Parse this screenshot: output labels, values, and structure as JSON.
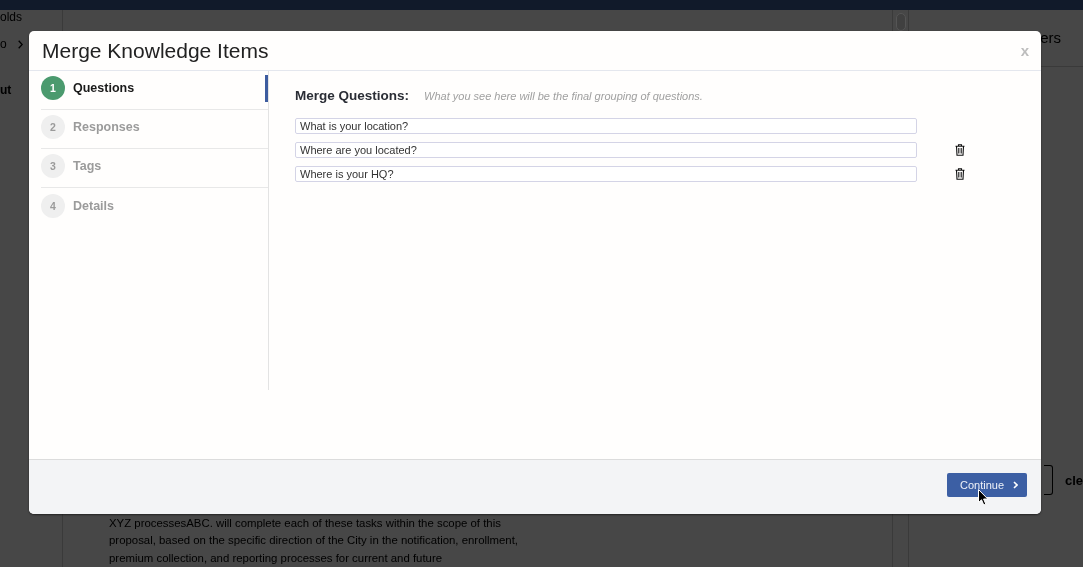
{
  "background_page": {
    "sidebar_items": [
      {
        "label": "olds",
        "chevron": false
      },
      {
        "label": "o",
        "chevron": true
      },
      {
        "label": "ut",
        "chevron": false
      }
    ],
    "panel_title": "ers",
    "panel_link": "cle",
    "body_text": "XYZ processesABC. will complete each of these tasks within the scope of this proposal, based on the specific direction of the City in the notification, enrollment, premium collection, and reporting processes for current and future"
  },
  "modal": {
    "title": "Merge Knowledge Items",
    "close_label": "x",
    "steps": [
      {
        "number": "1",
        "label": "Questions",
        "selected": true
      },
      {
        "number": "2",
        "label": "Responses",
        "selected": false
      },
      {
        "number": "3",
        "label": "Tags",
        "selected": false
      },
      {
        "number": "4",
        "label": "Details",
        "selected": false
      }
    ],
    "section_title": "Merge Questions:",
    "hint": "What you see here will be the final grouping of questions.",
    "questions": [
      {
        "value": "What is your location?",
        "deletable": false
      },
      {
        "value": "Where are you located?",
        "deletable": true
      },
      {
        "value": "Where is your HQ?",
        "deletable": true
      }
    ],
    "continue_label": "Continue"
  }
}
